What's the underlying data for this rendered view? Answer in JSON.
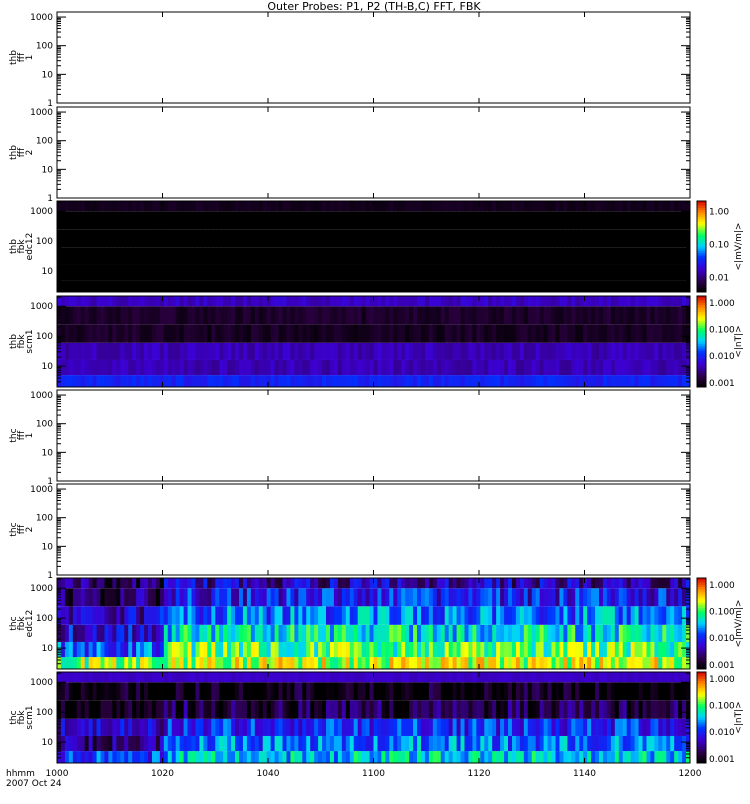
{
  "chart_data": {
    "type": "heatmap",
    "title": "Outer Probes: P1, P2 (TH-B,C) FFT, FBK",
    "x_label": "hhmm",
    "date": "2007 Oct 24",
    "x_range_minutes": [
      600,
      720
    ],
    "x_ticks": [
      {
        "label": "1000",
        "minute": 600
      },
      {
        "label": "1020",
        "minute": 620
      },
      {
        "label": "1040",
        "minute": 640
      },
      {
        "label": "1100",
        "minute": 660
      },
      {
        "label": "1120",
        "minute": 680
      },
      {
        "label": "1140",
        "minute": 700
      },
      {
        "label": "1200",
        "minute": 720
      }
    ],
    "band_edges_hz": [
      2,
      5,
      16,
      60,
      250,
      1000,
      2200
    ],
    "panels": [
      {
        "ylabel": [
          "thb",
          "fff",
          "1"
        ],
        "yrange": [
          1,
          1500
        ],
        "yticks": [
          "1",
          "10",
          "100",
          "1000"
        ],
        "empty": true
      },
      {
        "ylabel": [
          "thb",
          "fff",
          "2"
        ],
        "yrange": [
          1,
          1500
        ],
        "yticks": [
          "1",
          "10",
          "100",
          "1000"
        ],
        "empty": true
      },
      {
        "ylabel": [
          "thb",
          "fbk",
          "edc12"
        ],
        "yrange": [
          2,
          2200
        ],
        "yticks": [
          "10",
          "100",
          "1000"
        ],
        "empty": false,
        "colorbar": {
          "units": "<|mV/m|>",
          "range": [
            0.0037,
            2.1
          ],
          "ticks": [
            "0.01",
            "0.10",
            "1.00"
          ]
        },
        "band_values_before_1020": [
          0.0009,
          0.0003,
          0.0003,
          0.0003,
          0.0003,
          0.005
        ],
        "band_values_after_1020": [
          0.0009,
          0.0003,
          0.0003,
          0.0003,
          0.0003,
          0.005
        ],
        "variability_decades": 0.05
      },
      {
        "ylabel": [
          "thb",
          "fbk",
          "scm1"
        ],
        "yrange": [
          2,
          2200
        ],
        "yticks": [
          "10",
          "100",
          "1000"
        ],
        "empty": false,
        "colorbar": {
          "units": "<|nT|>",
          "range": [
            0.0007,
            1.8
          ],
          "ticks": [
            "0.001",
            "0.010",
            "0.100",
            "1.000"
          ]
        },
        "band_values_before_1020": [
          0.01,
          0.004,
          0.004,
          0.0012,
          0.0012,
          0.0045
        ],
        "band_values_after_1020": [
          0.01,
          0.004,
          0.004,
          0.0011,
          0.0012,
          0.0045
        ],
        "variability_decades": 0.12
      },
      {
        "ylabel": [
          "thc",
          "fff",
          "1"
        ],
        "yrange": [
          1,
          1500
        ],
        "yticks": [
          "1",
          "10",
          "100",
          "1000"
        ],
        "empty": true
      },
      {
        "ylabel": [
          "thc",
          "fff",
          "2"
        ],
        "yrange": [
          1,
          1500
        ],
        "yticks": [
          "1",
          "10",
          "100",
          "1000"
        ],
        "empty": true
      },
      {
        "ylabel": [
          "thc",
          "fbk",
          "edc12"
        ],
        "yrange": [
          2,
          2200
        ],
        "yticks": [
          "10",
          "100",
          "1000"
        ],
        "empty": false,
        "colorbar": {
          "units": "<|mV/m|>",
          "range": [
            0.0007,
            1.8
          ],
          "ticks": [
            "0.001",
            "0.010",
            "0.100",
            "1.000"
          ]
        },
        "band_values_before_1020": [
          0.15,
          0.015,
          0.006,
          0.005,
          0.002,
          0.002
        ],
        "band_values_after_1020": [
          0.2,
          0.1,
          0.05,
          0.02,
          0.008,
          0.004
        ],
        "variability_decades": 0.5
      },
      {
        "ylabel": [
          "thc",
          "fbk",
          "scm1"
        ],
        "yrange": [
          2,
          2200
        ],
        "yticks": [
          "10",
          "100",
          "1000"
        ],
        "empty": false,
        "colorbar": {
          "units": "<|nT|>",
          "range": [
            0.0007,
            1.8
          ],
          "ticks": [
            "0.001",
            "0.010",
            "0.100",
            "1.000"
          ]
        },
        "band_values_before_1020": [
          0.012,
          0.0025,
          0.005,
          0.0008,
          0.0008,
          0.0045
        ],
        "band_values_after_1020": [
          0.04,
          0.02,
          0.01,
          0.0015,
          0.0008,
          0.0045
        ],
        "variability_decades": 0.45
      }
    ]
  }
}
